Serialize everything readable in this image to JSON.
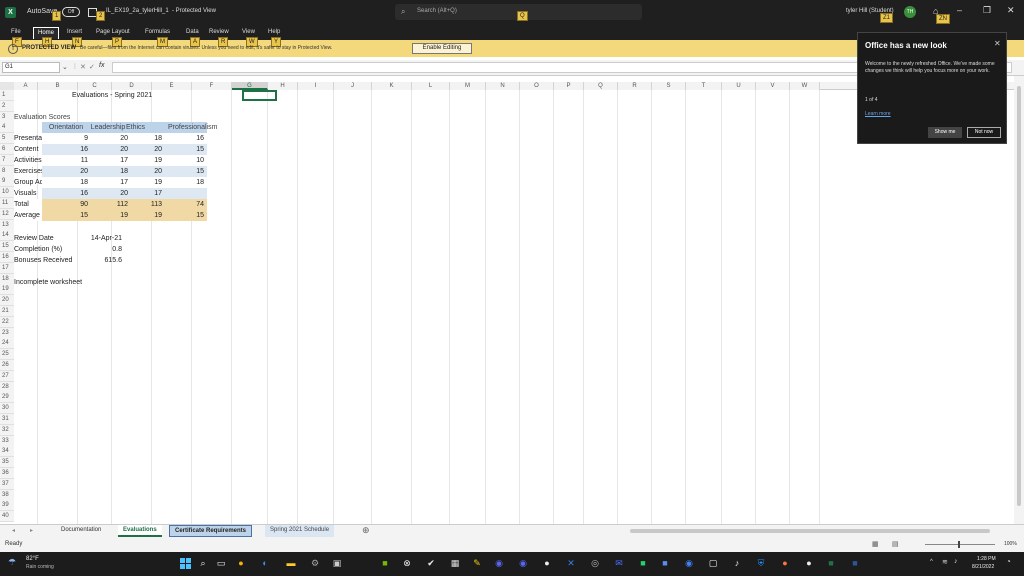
{
  "title_bar": {
    "autosave": "AutoSave",
    "toggle": "Off",
    "filename": "IL_EX19_2a_tylerHill_1",
    "view_mode": "- Protected View",
    "search_placeholder": "Search (Alt+Q)",
    "user": "tyler Hill (Student)",
    "avatar": "TH"
  },
  "keytips": {
    "autosave": "1",
    "filename": "2",
    "search": "Q",
    "user": "Z1",
    "share": "ZN",
    "file": "F",
    "home": "H",
    "insert": "N",
    "page": "P",
    "formulas": "M",
    "data": "A",
    "review": "R",
    "view": "W",
    "help": "Y"
  },
  "ribbon": {
    "tabs": [
      "File",
      "Home",
      "Insert",
      "Page Layout",
      "Formulas",
      "Data",
      "Review",
      "View",
      "Help"
    ],
    "active": "Home"
  },
  "protected": {
    "label": "PROTECTED VIEW",
    "message": "Be careful—files from the Internet can contain viruses. Unless you need to edit, it's safer to stay in Protected View.",
    "button": "Enable Editing"
  },
  "formula_bar": {
    "name_box": "G1",
    "fx": "fx",
    "value": ""
  },
  "columns": [
    "A",
    "B",
    "C",
    "D",
    "E",
    "F",
    "G",
    "H",
    "I",
    "J",
    "K",
    "L",
    "M",
    "N",
    "O",
    "P",
    "Q",
    "R",
    "S",
    "T",
    "U",
    "V",
    "W"
  ],
  "rows": [
    "1",
    "2",
    "3",
    "4",
    "5",
    "6",
    "7",
    "8",
    "9",
    "10",
    "11",
    "12",
    "13",
    "14",
    "15",
    "16",
    "17",
    "18",
    "19",
    "20",
    "21",
    "22",
    "23",
    "24",
    "25",
    "26",
    "27",
    "28",
    "29",
    "30",
    "31",
    "32",
    "33",
    "34",
    "35",
    "36",
    "37",
    "38",
    "39",
    "40"
  ],
  "sheet": {
    "title": "Evaluations - Spring 2021",
    "section": "Evaluation Scores",
    "headers": [
      "Orientation",
      "Leadership",
      "Ethics",
      "Professionalism"
    ],
    "data_rows": [
      {
        "label": "Presentation",
        "v": [
          "9",
          "20",
          "18",
          "16"
        ]
      },
      {
        "label": "Content",
        "v": [
          "16",
          "20",
          "20",
          "15"
        ]
      },
      {
        "label": "Activities",
        "v": [
          "11",
          "17",
          "19",
          "10"
        ]
      },
      {
        "label": "Exercises",
        "v": [
          "20",
          "18",
          "20",
          "15"
        ]
      },
      {
        "label": "Group Activities",
        "v": [
          "18",
          "17",
          "19",
          "18"
        ]
      },
      {
        "label": "Visuals",
        "v": [
          "16",
          "20",
          "17",
          ""
        ]
      }
    ],
    "total": {
      "label": "Total",
      "v": [
        "90",
        "112",
        "113",
        "74"
      ]
    },
    "average": {
      "label": "Average",
      "v": [
        "15",
        "19",
        "19",
        "15"
      ]
    },
    "review_date_label": "Review Date",
    "review_date": "14-Apr-21",
    "completion_label": "Completion (%)",
    "completion": "0.8",
    "bonus_label": "Bonuses Received",
    "bonus": "615.6",
    "note": "Incomplete worksheet"
  },
  "tabs": [
    "Documentation",
    "Evaluations",
    "Certificate Requirements",
    "Spring 2021 Schedule"
  ],
  "active_tab": "Evaluations",
  "status": {
    "ready": "Ready",
    "zoom": "100%"
  },
  "popup": {
    "title": "Office has a new look",
    "body": "Welcome to the newly refreshed Office. We've made some changes we think will help you focus more on your work.",
    "counter": "1 of 4",
    "link": "Learn more",
    "show": "Show me",
    "not_now": "Not now"
  },
  "taskbar": {
    "temp": "82°F",
    "weather": "Rain coming",
    "time": "1:28 PM",
    "date": "8/21/2022"
  }
}
